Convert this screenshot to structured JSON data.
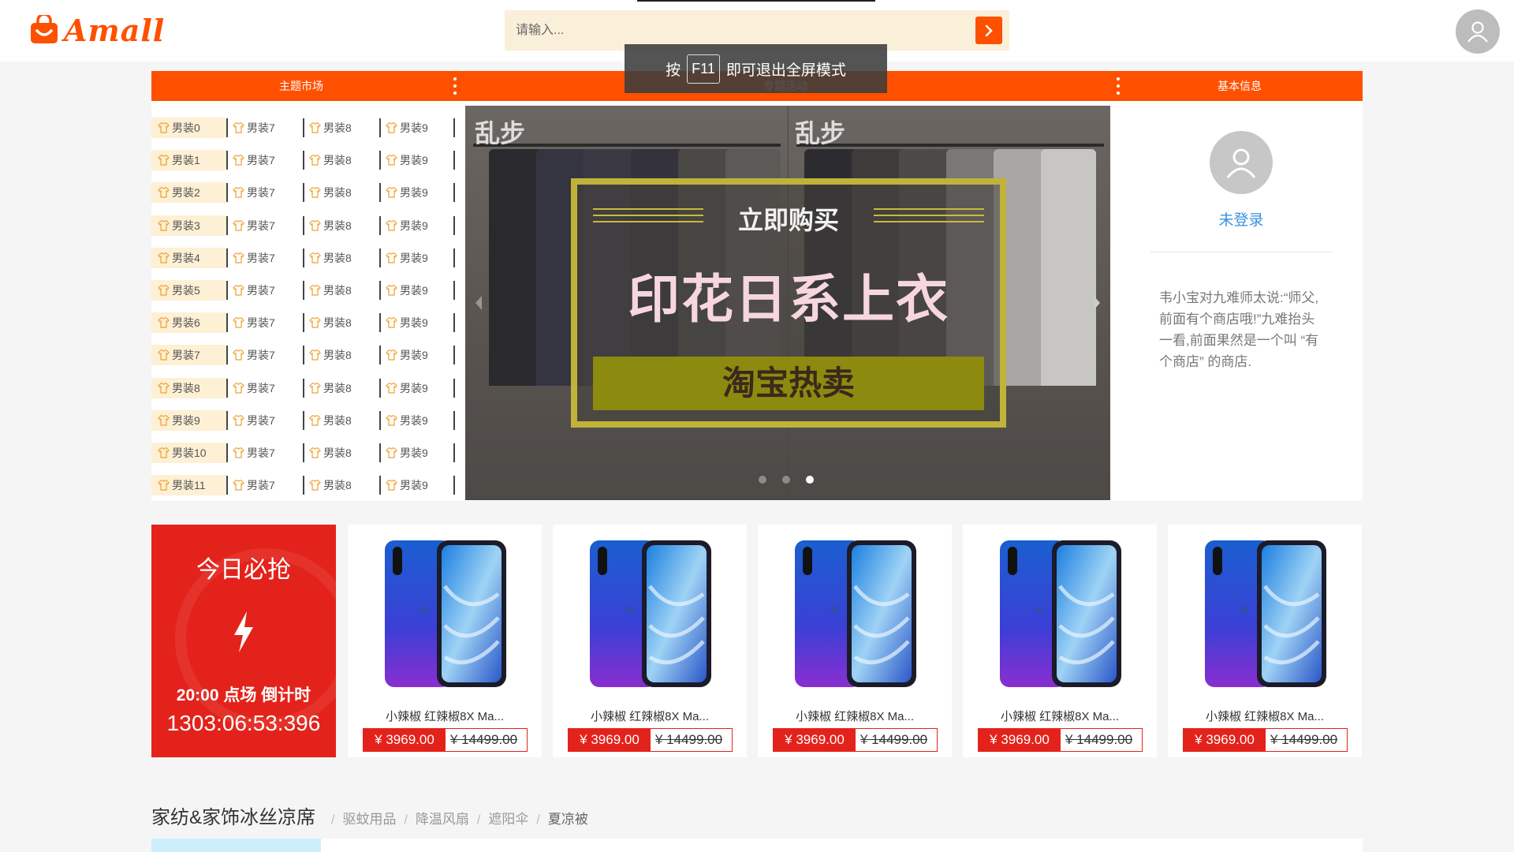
{
  "header": {
    "logo_text": "Amall",
    "search": {
      "placeholder": "请输入...",
      "value": ""
    },
    "icons": {
      "search_submit": "chevron-right-icon",
      "account": "user-icon"
    }
  },
  "fullscreen_toast": {
    "prefix": "按",
    "key": "F11",
    "suffix": "即可退出全屏模式"
  },
  "nav": {
    "left": "主题市场",
    "center": "专题活动",
    "right": "基本信息"
  },
  "categories": [
    [
      "男装0",
      "男装7",
      "男装8",
      "男装9"
    ],
    [
      "男装1",
      "男装7",
      "男装8",
      "男装9"
    ],
    [
      "男装2",
      "男装7",
      "男装8",
      "男装9"
    ],
    [
      "男装3",
      "男装7",
      "男装8",
      "男装9"
    ],
    [
      "男装4",
      "男装7",
      "男装8",
      "男装9"
    ],
    [
      "男装5",
      "男装7",
      "男装8",
      "男装9"
    ],
    [
      "男装6",
      "男装7",
      "男装8",
      "男装9"
    ],
    [
      "男装7",
      "男装7",
      "男装8",
      "男装9"
    ],
    [
      "男装8",
      "男装7",
      "男装8",
      "男装9"
    ],
    [
      "男装9",
      "男装7",
      "男装8",
      "男装9"
    ],
    [
      "男装10",
      "男装7",
      "男装8",
      "男装9"
    ],
    [
      "男装11",
      "男装7",
      "男装8",
      "男装9"
    ]
  ],
  "banner": {
    "brand_left": "乱步",
    "brand_right": "乱步",
    "headline_small": "立即购买",
    "headline_big": "印花日系上衣",
    "headline_bar": "淘宝热卖",
    "slide_count": 3,
    "active_slide": 3
  },
  "user_panel": {
    "login_text": "未登录",
    "story": "韦小宝对九难师太说:“师父,前面有个商店哦!”九难抬头一看,前面果然是一个叫 “有个商店” 的商店."
  },
  "flash_sale": {
    "title": "今日必抢",
    "session": "20:00 点场 倒计时",
    "countdown": "1303:06:53:396",
    "icon": "lightning-icon"
  },
  "products": [
    {
      "name": "小辣椒 红辣椒8X Ma...",
      "price": "¥ 3969.00",
      "old_price": "¥ 14499.00"
    },
    {
      "name": "小辣椒 红辣椒8X Ma...",
      "price": "¥ 3969.00",
      "old_price": "¥ 14499.00"
    },
    {
      "name": "小辣椒 红辣椒8X Ma...",
      "price": "¥ 3969.00",
      "old_price": "¥ 14499.00"
    },
    {
      "name": "小辣椒 红辣椒8X Ma...",
      "price": "¥ 3969.00",
      "old_price": "¥ 14499.00"
    },
    {
      "name": "小辣椒 红辣椒8X Ma...",
      "price": "¥ 3969.00",
      "old_price": "¥ 14499.00"
    }
  ],
  "floor": {
    "title": "家纺&家饰冰丝凉席",
    "links": [
      "驱蚊用品",
      "降温风扇",
      "遮阳伞",
      "夏凉被"
    ]
  },
  "colors": {
    "brand": "#ff5000",
    "sale_red": "#e3231b",
    "link_blue": "#3b8fe0",
    "search_bg": "#faefd9"
  }
}
